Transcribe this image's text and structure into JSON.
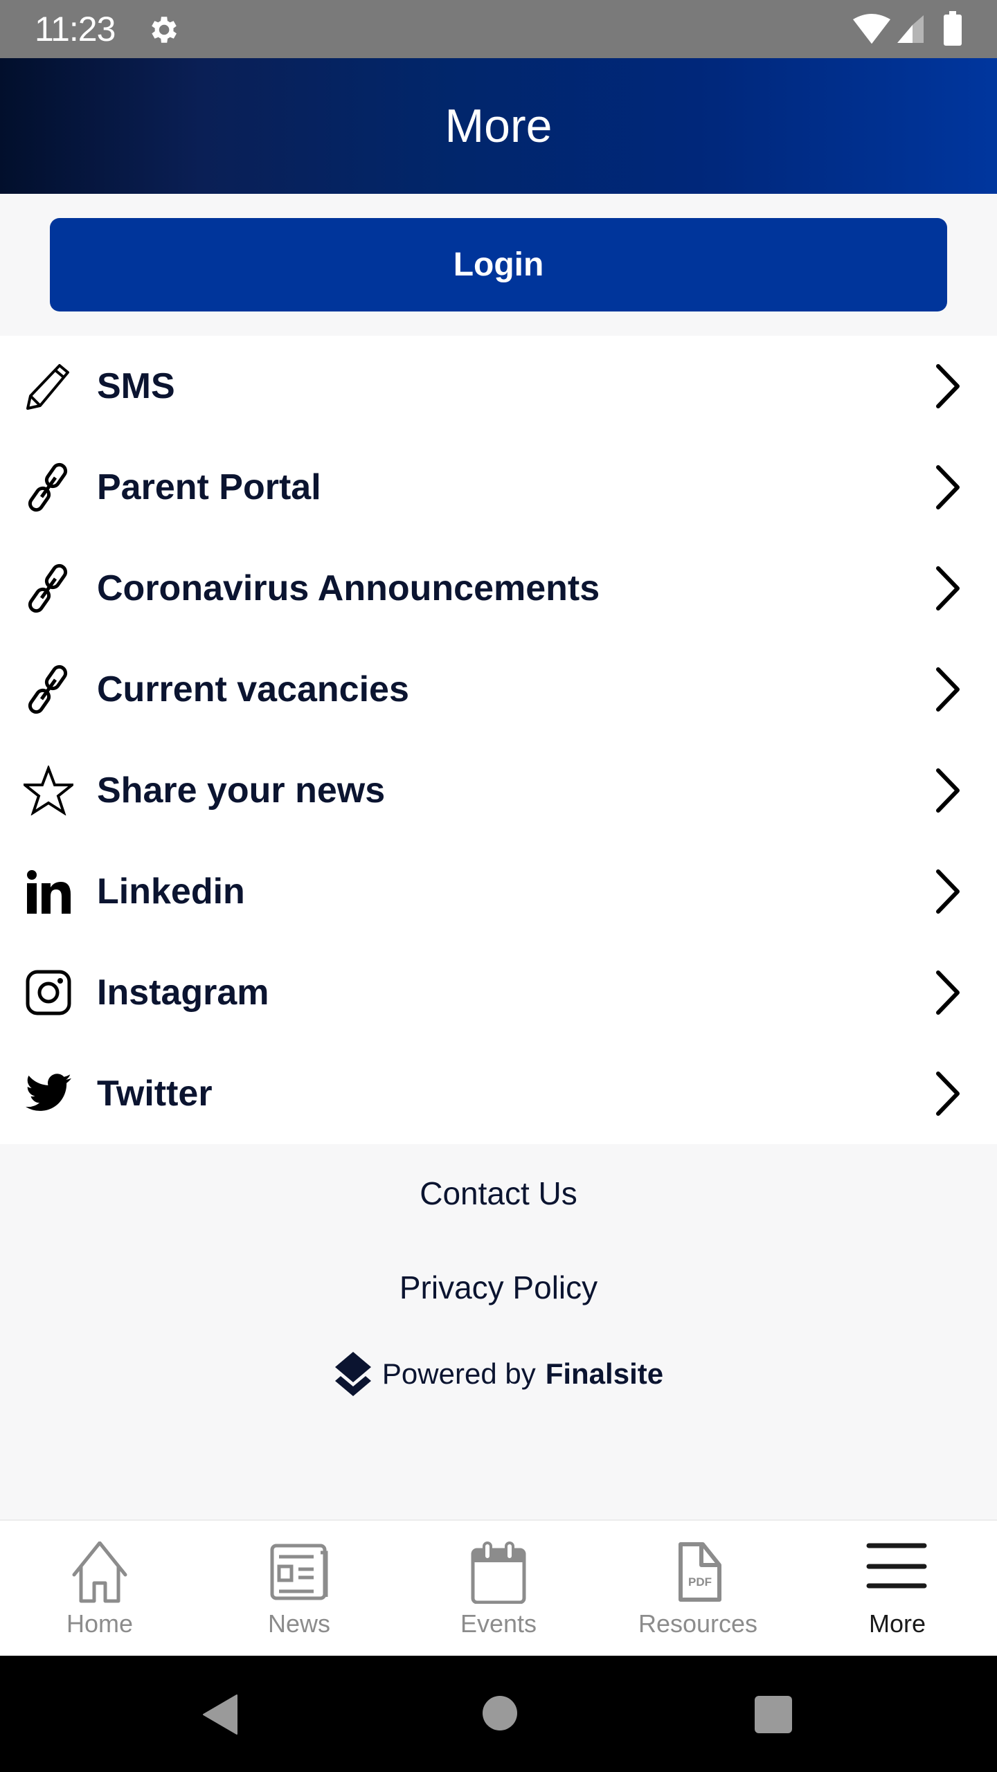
{
  "status_bar": {
    "time": "11:23",
    "icons": [
      "gear-icon",
      "wifi-icon",
      "signal-icon",
      "battery-icon"
    ]
  },
  "header": {
    "title": "More"
  },
  "login": {
    "label": "Login",
    "color": "#00359b"
  },
  "menu": {
    "items": [
      {
        "label": "SMS",
        "icon": "pencil-icon"
      },
      {
        "label": "Parent Portal",
        "icon": "link-icon"
      },
      {
        "label": "Coronavirus Announcements",
        "icon": "link-icon"
      },
      {
        "label": "Current vacancies",
        "icon": "link-icon"
      },
      {
        "label": "Share your news",
        "icon": "star-icon"
      },
      {
        "label": "Linkedin",
        "icon": "linkedin-icon"
      },
      {
        "label": "Instagram",
        "icon": "instagram-icon"
      },
      {
        "label": "Twitter",
        "icon": "twitter-icon"
      }
    ],
    "chevron_icon": "chevron-right-icon"
  },
  "footer": {
    "contact": "Contact Us",
    "privacy": "Privacy Policy",
    "powered_prefix": "Powered by",
    "powered_brand": "Finalsite"
  },
  "bottom_nav": {
    "tabs": [
      {
        "label": "Home",
        "icon": "home-icon",
        "active": false
      },
      {
        "label": "News",
        "icon": "newspaper-icon",
        "active": false
      },
      {
        "label": "Events",
        "icon": "calendar-icon",
        "active": false
      },
      {
        "label": "Resources",
        "icon": "pdf-file-icon",
        "active": false
      },
      {
        "label": "More",
        "icon": "hamburger-menu-icon",
        "active": true
      }
    ]
  },
  "colors": {
    "header_gradient_start": "#020f2c",
    "header_gradient_end": "#00369e",
    "text_dark": "#0b1430",
    "inactive_tab": "#8c8c8c"
  }
}
